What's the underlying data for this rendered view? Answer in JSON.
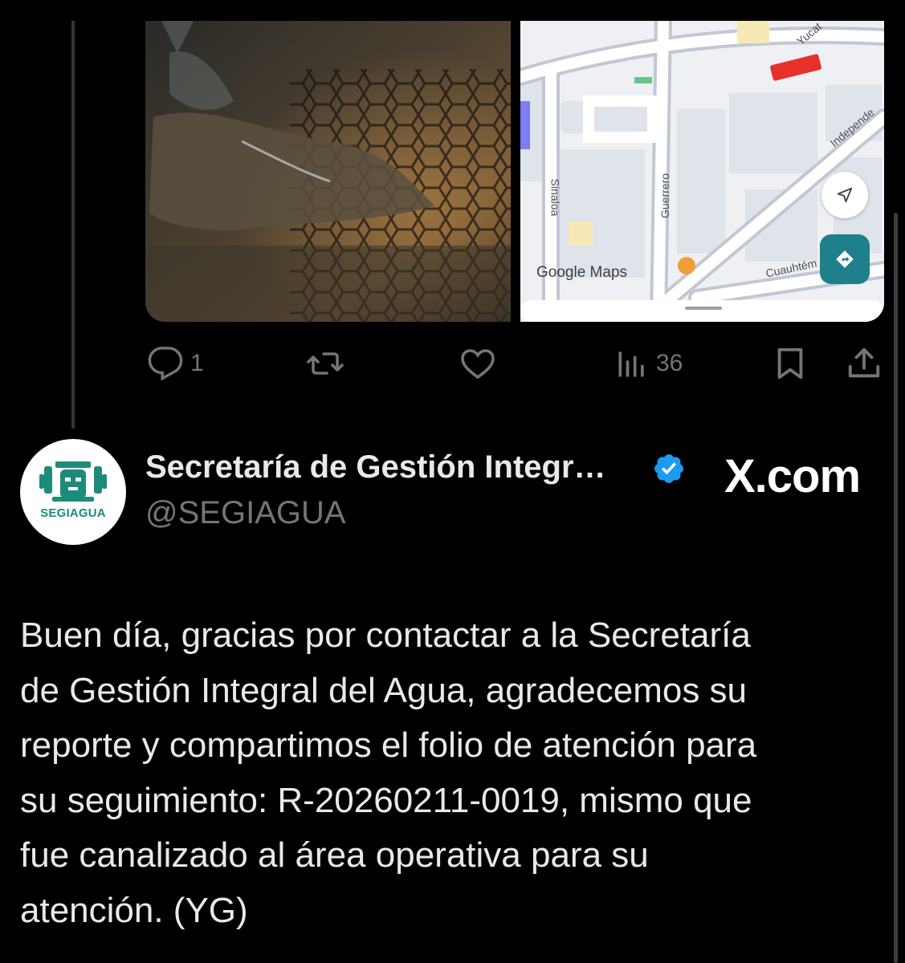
{
  "media": {
    "map": {
      "brand": "Google Maps",
      "streets": [
        "Sinaloa",
        "Guerrero",
        "Independencia",
        "Cuauhtémoc",
        "Yucatán"
      ],
      "street_labels_visible": [
        "Sinaloa",
        "Guerrero",
        "Independe",
        "Cuauhtém",
        "Yucat"
      ],
      "marker_color": "#e6312b",
      "action_button_color": "#1f7f8b"
    }
  },
  "actions": {
    "reply_count": "1",
    "views_count": "36"
  },
  "author": {
    "avatar_text": "SEGIAGUA",
    "name": "Secretaría de Gestión Integr…",
    "handle": "@SEGIAGUA",
    "verified": true,
    "accent_color": "#1d9bf0"
  },
  "source": "X.com",
  "tweet": {
    "text": "Buen día, gracias por contactar a la Secretaría\nde Gestión Integral del Agua, agradecemos su\nreporte y compartimos el folio de atención para\nsu seguimiento: R-20260211-0019, mismo que\nfue canalizado al área operativa para su\natención. (YG)"
  },
  "colors": {
    "background": "#000000",
    "text_primary": "#e7e9ea",
    "text_secondary": "#71767b",
    "logo_green": "#1d8b7a"
  }
}
